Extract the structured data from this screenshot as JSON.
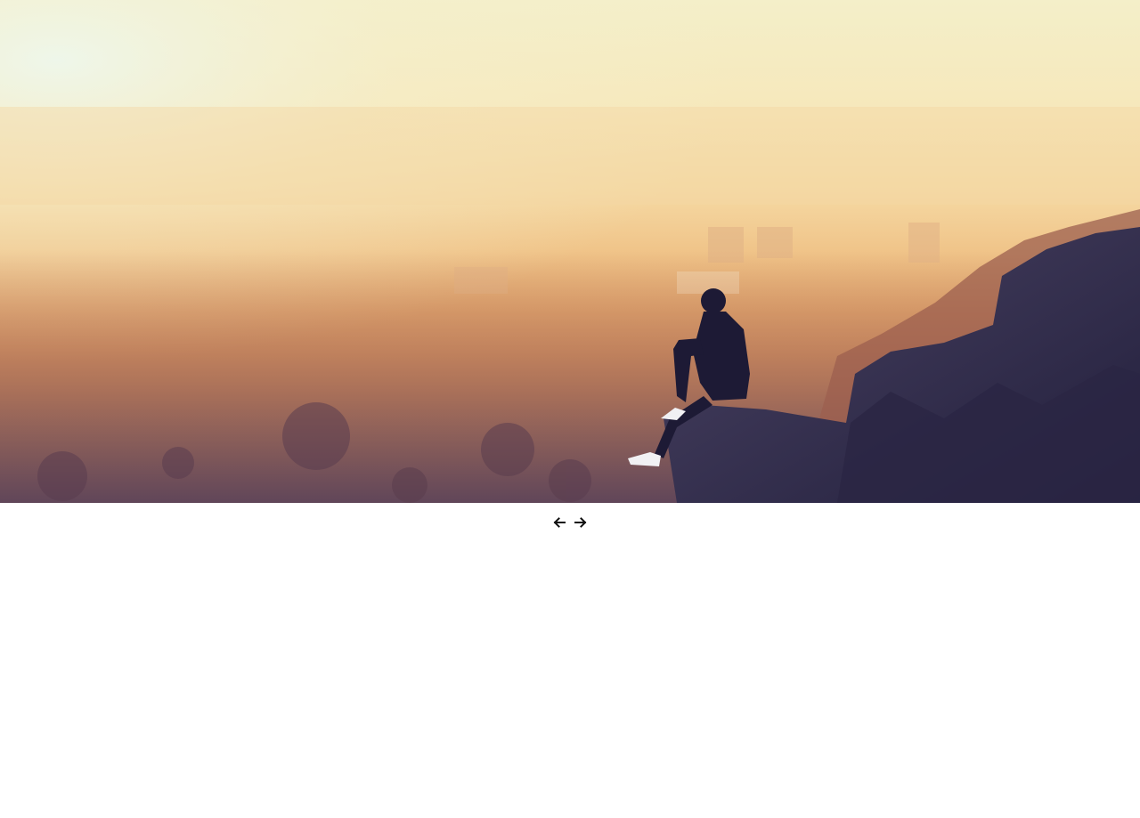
{
  "slider": {
    "image_icon": "sunset-landscape-photo",
    "prev_icon": "arrow-left-icon",
    "next_icon": "arrow-right-icon"
  },
  "colors": {
    "sky_top": "#f6efc8",
    "haze": "#f2c98a",
    "city": "#b97a52",
    "rock": "#2e2a4a",
    "silhouette": "#1c1a33",
    "arrow": "#111111"
  }
}
